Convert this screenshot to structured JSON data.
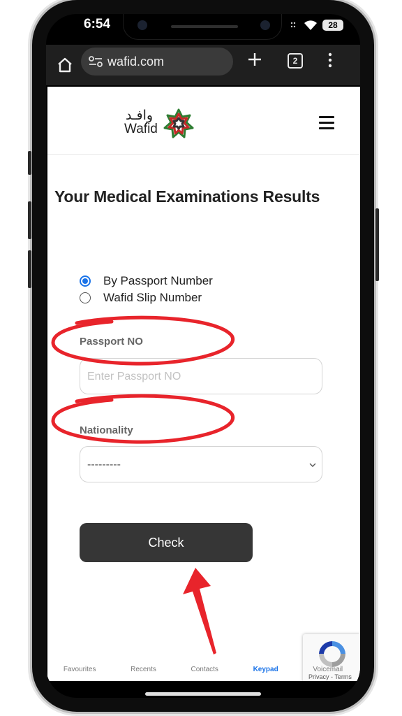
{
  "status_bar": {
    "time": "6:54",
    "battery": "28"
  },
  "browser": {
    "url": "wafid.com",
    "tab_count": "2"
  },
  "brand": {
    "name_ar": "وافـد",
    "name_en": "Wafid"
  },
  "page": {
    "title": "Your Medical Examinations Results",
    "search_options": [
      {
        "label": "By Passport Number",
        "selected": true
      },
      {
        "label": "Wafid Slip Number",
        "selected": false
      }
    ],
    "passport": {
      "label": "Passport NO",
      "placeholder": "Enter Passport NO"
    },
    "nationality": {
      "label": "Nationality",
      "value": "---------"
    },
    "check_button": "Check"
  },
  "recaptcha": {
    "links": "Privacy - Terms"
  },
  "dock": {
    "items": [
      "Favourites",
      "Recents",
      "Contacts",
      "Keypad",
      "Voicemail"
    ],
    "active": "Keypad"
  },
  "colors": {
    "accent": "#1a73e8",
    "annotation": "#e8242b",
    "button": "#363636"
  }
}
